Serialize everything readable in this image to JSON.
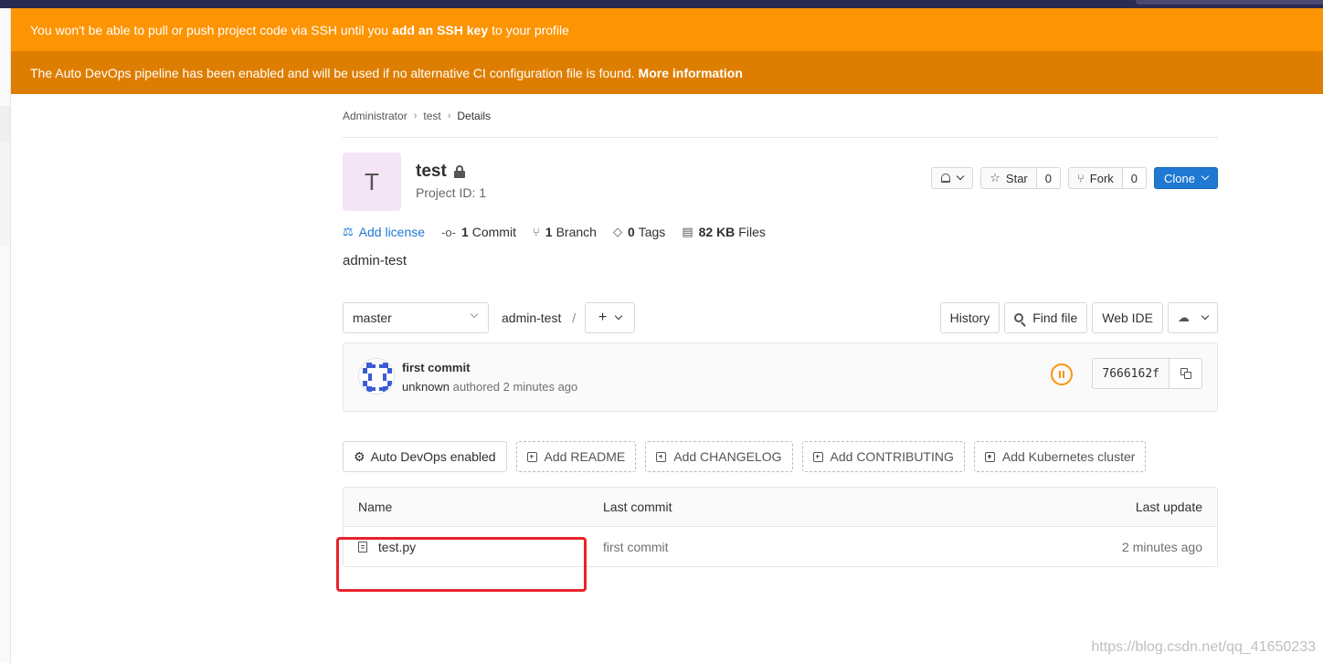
{
  "banners": {
    "ssh": {
      "prefix": "You won't be able to pull or push project code via SSH until you",
      "link": "add an SSH key",
      "suffix": "to your profile"
    },
    "devops": {
      "text": "The Auto DevOps pipeline has been enabled and will be used if no alternative CI configuration file is found.",
      "link": "More information"
    }
  },
  "breadcrumb": {
    "items": [
      "Administrator",
      "test"
    ],
    "current": "Details"
  },
  "project": {
    "avatar_letter": "T",
    "name": "test",
    "project_id": "Project ID: 1",
    "star_label": "Star",
    "star_count": "0",
    "fork_label": "Fork",
    "fork_count": "0",
    "clone_label": "Clone",
    "description": "admin-test"
  },
  "stats": {
    "license": "Add license",
    "commits_count": "1",
    "commits_label": "Commit",
    "branches_count": "1",
    "branches_label": "Branch",
    "tags_count": "0",
    "tags_label": "Tags",
    "files_size": "82 KB",
    "files_label": "Files"
  },
  "tree": {
    "branch": "master",
    "path": "admin-test",
    "slash": "/",
    "plus": "+",
    "history": "History",
    "find_file": "Find file",
    "web_ide": "Web IDE"
  },
  "commit": {
    "title": "first commit",
    "author": "unknown",
    "authored": "authored 2 minutes ago",
    "sha": "7666162f"
  },
  "quick_actions": {
    "auto_devops": "Auto DevOps enabled",
    "readme": "Add README",
    "changelog": "Add CHANGELOG",
    "contributing": "Add CONTRIBUTING",
    "kubernetes": "Add Kubernetes cluster"
  },
  "files": {
    "headers": {
      "name": "Name",
      "last_commit": "Last commit",
      "last_update": "Last update"
    },
    "rows": [
      {
        "name": "test.py",
        "last_commit": "first commit",
        "last_update": "2 minutes ago"
      }
    ]
  },
  "watermark": "https://blog.csdn.net/qq_41650233",
  "colors": {
    "ssh_banner": "#fc9403",
    "devops_banner": "#de7e00",
    "primary": "#1f78d1",
    "highlight": "#e8232a",
    "avatar_bg": "#f3e5f5"
  }
}
